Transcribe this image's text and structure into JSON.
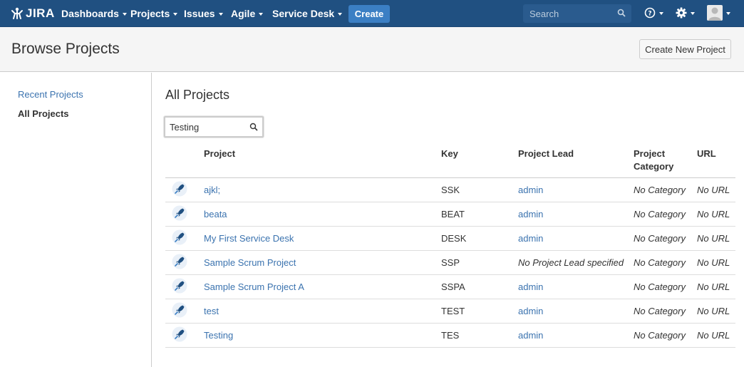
{
  "brand": {
    "name": "JIRA"
  },
  "nav": {
    "items": [
      "Dashboards",
      "Projects",
      "Issues",
      "Agile",
      "Service Desk"
    ],
    "create_label": "Create",
    "search_placeholder": "Search"
  },
  "header": {
    "title": "Browse Projects",
    "create_button": "Create New Project"
  },
  "sidebar": {
    "items": [
      {
        "label": "Recent Projects"
      },
      {
        "label": "All Projects"
      }
    ]
  },
  "main": {
    "title": "All Projects",
    "filter_value": "Testing",
    "columns": [
      "Project",
      "Key",
      "Project Lead",
      "Project Category",
      "URL"
    ],
    "rows": [
      {
        "name": "ajkl;",
        "key": "SSK",
        "lead": "admin",
        "category": "No Category",
        "url": "No URL"
      },
      {
        "name": "beata",
        "key": "BEAT",
        "lead": "admin",
        "category": "No Category",
        "url": "No URL"
      },
      {
        "name": "My First Service Desk",
        "key": "DESK",
        "lead": "admin",
        "category": "No Category",
        "url": "No URL"
      },
      {
        "name": "Sample Scrum Project",
        "key": "SSP",
        "lead": "No Project Lead specified",
        "category": "No Category",
        "url": "No URL"
      },
      {
        "name": "Sample Scrum Project A",
        "key": "SSPA",
        "lead": "admin",
        "category": "No Category",
        "url": "No URL"
      },
      {
        "name": "test",
        "key": "TEST",
        "lead": "admin",
        "category": "No Category",
        "url": "No URL"
      },
      {
        "name": "Testing",
        "key": "TES",
        "lead": "admin",
        "category": "No Category",
        "url": "No URL"
      }
    ]
  },
  "icons": {
    "project": "rocket-icon",
    "search": "search-icon",
    "help": "help-icon",
    "settings": "gear-icon"
  },
  "colors": {
    "nav_bg": "#205081",
    "link": "#3b73af",
    "create_btn": "#3b7fc4"
  }
}
